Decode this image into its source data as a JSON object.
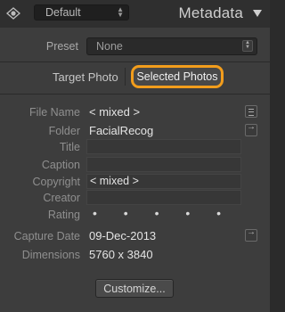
{
  "header": {
    "preset_value": "Default",
    "panel_title": "Metadata"
  },
  "preset": {
    "label": "Preset",
    "value": "None"
  },
  "target": {
    "target_photo": "Target Photo",
    "selected_photos": "Selected Photos",
    "highlight_color": "#f29d1c"
  },
  "fields": {
    "file_name": {
      "label": "File Name",
      "value": "< mixed >"
    },
    "folder": {
      "label": "Folder",
      "value": "FacialRecog"
    },
    "title": {
      "label": "Title",
      "value": ""
    },
    "caption": {
      "label": "Caption",
      "value": ""
    },
    "copyright": {
      "label": "Copyright",
      "value": "< mixed >"
    },
    "creator": {
      "label": "Creator",
      "value": ""
    },
    "rating": {
      "label": "Rating",
      "value": "• • • • •"
    },
    "capture_date": {
      "label": "Capture Date",
      "value": "09-Dec-2013"
    },
    "dimensions": {
      "label": "Dimensions",
      "value": "5760 x 3840"
    }
  },
  "customize_button": "Customize..."
}
